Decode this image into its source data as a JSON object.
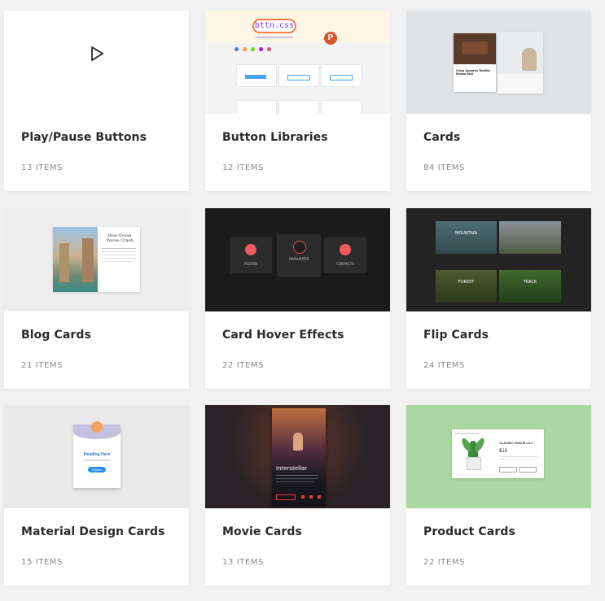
{
  "cards": [
    {
      "title": "Play/Pause Buttons",
      "count": "13 ITEMS"
    },
    {
      "title": "Button Libraries",
      "count": "12 ITEMS"
    },
    {
      "title": "Cards",
      "count": "84 ITEMS"
    },
    {
      "title": "Blog Cards",
      "count": "21 ITEMS"
    },
    {
      "title": "Card Hover Effects",
      "count": "22 ITEMS"
    },
    {
      "title": "Flip Cards",
      "count": "24 ITEMS"
    },
    {
      "title": "Material Design Cards",
      "count": "15 ITEMS"
    },
    {
      "title": "Movie Cards",
      "count": "13 ITEMS"
    },
    {
      "title": "Product Cards",
      "count": "22 ITEMS"
    }
  ],
  "previews": {
    "buttons_logo": "bttn.css",
    "blog_headline": "Blue Ocean Waves Crash",
    "hover_labels": [
      "FOOTAR",
      "FAVOURITES",
      "CONTACTS"
    ],
    "flip_labels": [
      "MOUNTAIN",
      "FOREST",
      "TRACK"
    ],
    "material_heading": "Heading Here",
    "material_button": "Button",
    "movie_title": "Interstellar",
    "product_name": "CLASSIC PEACE LILY",
    "product_price": "$18",
    "cards_title": "Crisp Spanish Tortilla Matzo Brei"
  },
  "colors": {
    "page_bg": "#f1f1f1",
    "card_bg": "#ffffff",
    "title_text": "#2b2b2b",
    "count_text": "#8a8a8a",
    "product_bg": "#a9d8a0"
  }
}
